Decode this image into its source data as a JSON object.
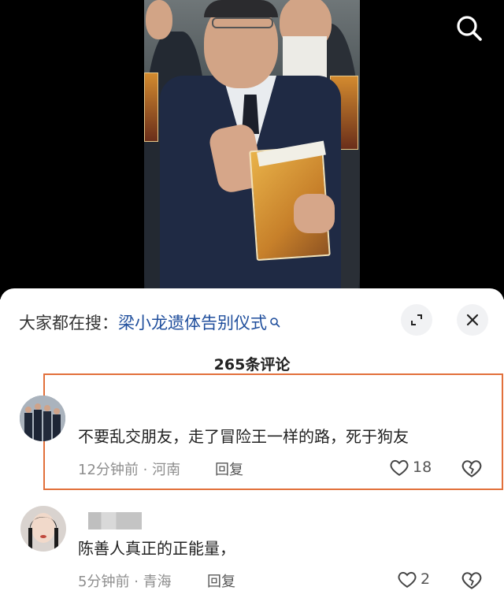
{
  "search_bar": {
    "prefix": "大家都在搜：",
    "topic": "梁小龙遗体告别仪式"
  },
  "comments_header": {
    "count_label": "265条评论"
  },
  "comments": [
    {
      "text": "不要乱交朋友，走了冒险王一样的路，死于狗友",
      "time": "12分钟前",
      "location": "河南",
      "reply_label": "回复",
      "likes": "18"
    },
    {
      "text": "陈善人真正的正能量，",
      "time": "5分钟前",
      "location": "青海",
      "reply_label": "回复",
      "likes": "2"
    }
  ],
  "colors": {
    "highlight": "#e2703b",
    "topic_link": "#1f4e9c"
  },
  "icons": [
    "search-icon",
    "expand-icon",
    "close-icon",
    "heart-icon",
    "broken-heart-icon"
  ]
}
